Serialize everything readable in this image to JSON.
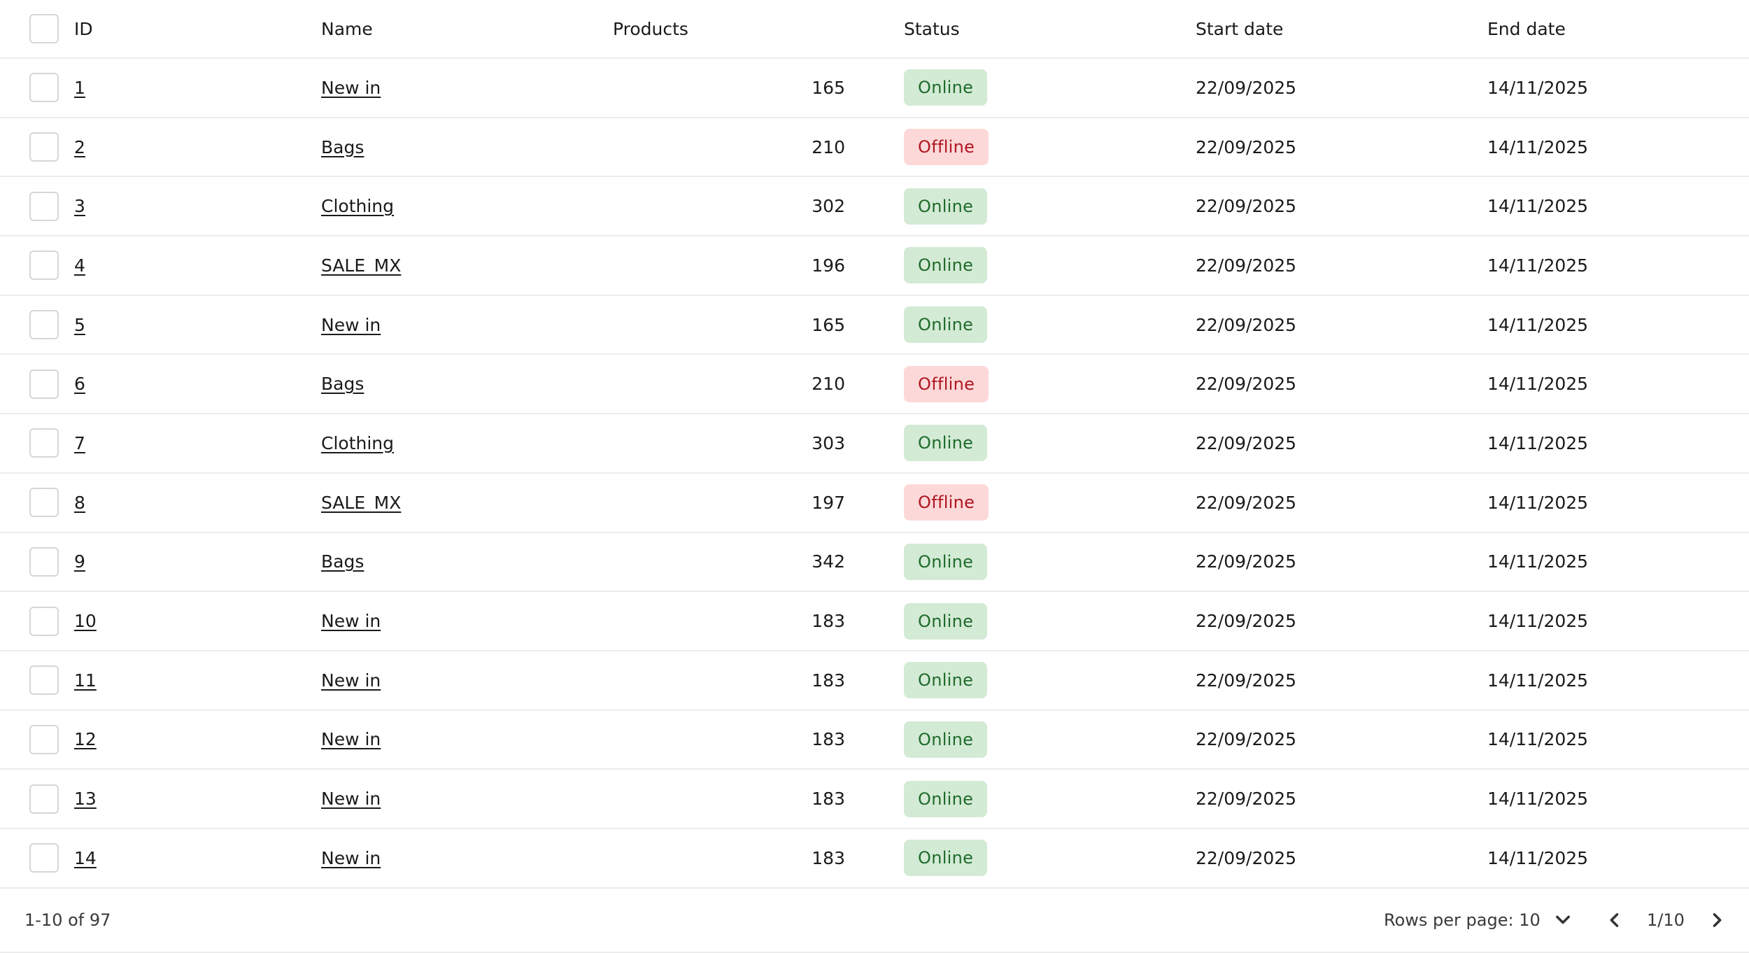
{
  "table": {
    "columns": {
      "id": "ID",
      "name": "Name",
      "products": "Products",
      "status": "Status",
      "start_date": "Start date",
      "end_date": "End date"
    },
    "rows": [
      {
        "id": "1",
        "name": "New in",
        "products": "165",
        "status": "Online",
        "start": "22/09/2025",
        "end": "14/11/2025"
      },
      {
        "id": "2",
        "name": "Bags",
        "products": "210",
        "status": "Offline",
        "start": "22/09/2025",
        "end": "14/11/2025"
      },
      {
        "id": "3",
        "name": "Clothing",
        "products": "302",
        "status": "Online",
        "start": "22/09/2025",
        "end": "14/11/2025"
      },
      {
        "id": "4",
        "name": "SALE_MX",
        "products": "196",
        "status": "Online",
        "start": "22/09/2025",
        "end": "14/11/2025"
      },
      {
        "id": "5",
        "name": "New in",
        "products": "165",
        "status": "Online",
        "start": "22/09/2025",
        "end": "14/11/2025"
      },
      {
        "id": "6",
        "name": "Bags",
        "products": "210",
        "status": "Offline",
        "start": "22/09/2025",
        "end": "14/11/2025"
      },
      {
        "id": "7",
        "name": "Clothing",
        "products": "303",
        "status": "Online",
        "start": "22/09/2025",
        "end": "14/11/2025"
      },
      {
        "id": "8",
        "name": "SALE_MX",
        "products": "197",
        "status": "Offline",
        "start": "22/09/2025",
        "end": "14/11/2025"
      },
      {
        "id": "9",
        "name": "Bags",
        "products": "342",
        "status": "Online",
        "start": "22/09/2025",
        "end": "14/11/2025"
      },
      {
        "id": "10",
        "name": "New in",
        "products": "183",
        "status": "Online",
        "start": "22/09/2025",
        "end": "14/11/2025"
      },
      {
        "id": "11",
        "name": "New in",
        "products": "183",
        "status": "Online",
        "start": "22/09/2025",
        "end": "14/11/2025"
      },
      {
        "id": "12",
        "name": "New in",
        "products": "183",
        "status": "Online",
        "start": "22/09/2025",
        "end": "14/11/2025"
      },
      {
        "id": "13",
        "name": "New in",
        "products": "183",
        "status": "Online",
        "start": "22/09/2025",
        "end": "14/11/2025"
      },
      {
        "id": "14",
        "name": "New in",
        "products": "183",
        "status": "Online",
        "start": "22/09/2025",
        "end": "14/11/2025"
      }
    ]
  },
  "footer": {
    "range_label": "1-10 of 97",
    "rows_per_page_label": "Rows per page: 10",
    "page_indicator": "1/10"
  },
  "icons": {
    "rows_per_page": "chevron-down-icon",
    "prev": "chevron-left-icon",
    "next": "chevron-right-icon"
  },
  "colors": {
    "online_bg": "#d3ead5",
    "online_text": "#1f6b2b",
    "offline_bg": "#fcd9d8",
    "offline_text": "#b01622"
  }
}
